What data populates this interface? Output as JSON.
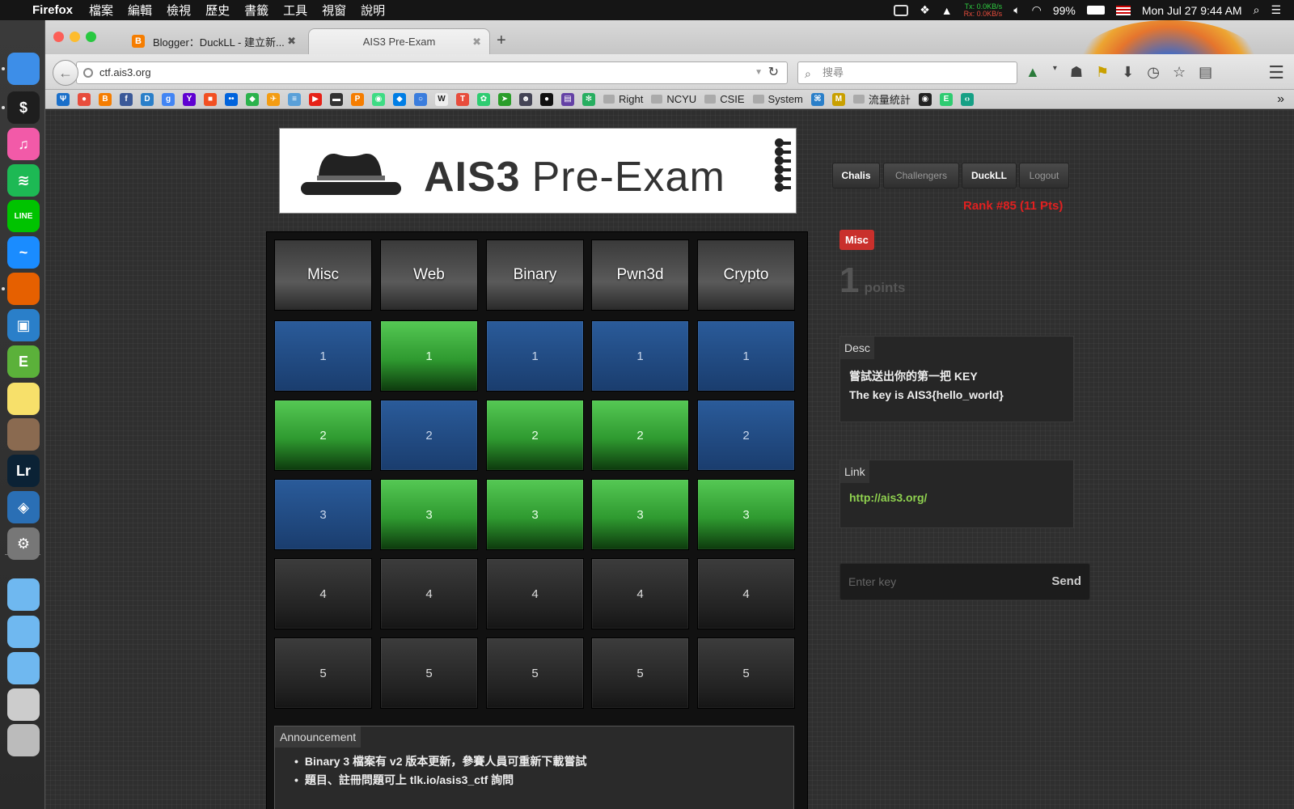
{
  "menubar": {
    "app": "Firefox",
    "menus": [
      "檔案",
      "編輯",
      "檢視",
      "歷史",
      "書籤",
      "工具",
      "視窗",
      "說明"
    ],
    "net_tx": "Tx:",
    "net_tx_val": "0.0KB/s",
    "net_rx": "Rx:",
    "net_rx_val": "0.0KB/s",
    "battery": "99%",
    "datetime": "Mon Jul 27  9:44 AM"
  },
  "dock": {
    "items": [
      {
        "name": "finder",
        "color": "#3d8ee8",
        "label": ""
      },
      {
        "name": "terminal",
        "color": "#1e1e1e",
        "label": "$"
      },
      {
        "name": "itunes",
        "color": "#f25aa8",
        "label": "♫"
      },
      {
        "name": "spotify",
        "color": "#1db954",
        "label": "≋"
      },
      {
        "name": "line",
        "color": "#00c300",
        "label": "LINE"
      },
      {
        "name": "messenger",
        "color": "#1a8cff",
        "label": "~"
      },
      {
        "name": "firefox",
        "color": "#e66000",
        "label": ""
      },
      {
        "name": "app-blue",
        "color": "#2a7fc9",
        "label": "▣"
      },
      {
        "name": "evernote",
        "color": "#5bb13a",
        "label": "E"
      },
      {
        "name": "stickies",
        "color": "#f7e06a",
        "label": ""
      },
      {
        "name": "armadillo",
        "color": "#8a6a50",
        "label": ""
      },
      {
        "name": "lightroom",
        "color": "#0b2235",
        "label": "Lr"
      },
      {
        "name": "virtualbox",
        "color": "#2a6fb5",
        "label": "◈"
      },
      {
        "name": "system-prefs",
        "color": "#777",
        "label": "⚙"
      },
      {
        "name": "dropbox-folder",
        "color": "#6fb8f0",
        "label": ""
      },
      {
        "name": "drive-folder",
        "color": "#6fb8f0",
        "label": ""
      },
      {
        "name": "folder",
        "color": "#6fb8f0",
        "label": ""
      },
      {
        "name": "disk",
        "color": "#ccc",
        "label": ""
      },
      {
        "name": "trash",
        "color": "#bbb",
        "label": ""
      }
    ]
  },
  "tabs": [
    {
      "title": "Blogger：DuckLL - 建立新...",
      "close": "✖"
    },
    {
      "title": "AIS3 Pre-Exam",
      "close": "✖"
    }
  ],
  "newtab": "+",
  "url": "ctf.ais3.org",
  "search_placeholder": "搜尋",
  "bookmarks": {
    "icons": [
      {
        "name": "bm-tt",
        "color": "#1a6fc9",
        "t": "Ψ"
      },
      {
        "name": "bm-maps",
        "color": "#e74c3c",
        "t": "●"
      },
      {
        "name": "bm-blogger",
        "color": "#f57d00",
        "t": "B"
      },
      {
        "name": "bm-facebook",
        "color": "#3b5998",
        "t": "f"
      },
      {
        "name": "bm-dict",
        "color": "#2a7fc9",
        "t": "D"
      },
      {
        "name": "bm-google",
        "color": "#4285f4",
        "t": "g"
      },
      {
        "name": "bm-yahoo",
        "color": "#5f01d1",
        "t": "Y"
      },
      {
        "name": "bm-windows",
        "color": "#f25022",
        "t": "■"
      },
      {
        "name": "bm-flickr",
        "color": "#0063dc",
        "t": "••"
      },
      {
        "name": "bm-feedly",
        "color": "#2bb24c",
        "t": "◆"
      },
      {
        "name": "bm-bird",
        "color": "#f39c12",
        "t": "✈"
      },
      {
        "name": "bm-doc",
        "color": "#5aa0d8",
        "t": "≡"
      },
      {
        "name": "bm-youtube",
        "color": "#e62117",
        "t": "▶"
      },
      {
        "name": "bm-card",
        "color": "#333",
        "t": "▬"
      },
      {
        "name": "bm-p",
        "color": "#f57d00",
        "t": "P"
      },
      {
        "name": "bm-android",
        "color": "#3ddc84",
        "t": "◉"
      },
      {
        "name": "bm-dropbox",
        "color": "#007ee5",
        "t": "◆"
      },
      {
        "name": "bm-circle",
        "color": "#3b7ddd",
        "t": "○"
      },
      {
        "name": "bm-wikipedia",
        "color": "#eee",
        "t": "W"
      },
      {
        "name": "bm-t",
        "color": "#e74c3c",
        "t": "T"
      },
      {
        "name": "bm-green",
        "color": "#2ecc71",
        "t": "✿"
      },
      {
        "name": "bm-plane",
        "color": "#2a9d2a",
        "t": "➤"
      },
      {
        "name": "bm-face",
        "color": "#445",
        "t": "☻"
      },
      {
        "name": "bm-lemon",
        "color": "#111",
        "t": "●"
      },
      {
        "name": "bm-twitch",
        "color": "#6441a5",
        "t": "▤"
      },
      {
        "name": "bm-leaf",
        "color": "#27ae60",
        "t": "✻"
      }
    ],
    "folders": [
      "Right",
      "NCYU",
      "CSIE",
      "System"
    ],
    "extra_label": "流量統計",
    "more": "»"
  },
  "banner": {
    "title_bold": "AIS3",
    "title_rest": "Pre-Exam"
  },
  "categories": [
    "Misc",
    "Web",
    "Binary",
    "Pwn3d",
    "Crypto"
  ],
  "grid": [
    [
      "blue",
      "green",
      "blue",
      "blue",
      "blue"
    ],
    [
      "green",
      "blue",
      "green",
      "green",
      "blue"
    ],
    [
      "blue",
      "green",
      "green",
      "green",
      "green"
    ],
    [
      "gray",
      "gray",
      "gray",
      "gray",
      "gray"
    ],
    [
      "gray",
      "gray",
      "gray",
      "gray",
      "gray"
    ]
  ],
  "rows": [
    "1",
    "2",
    "3",
    "4",
    "5"
  ],
  "announcement": {
    "header": "Announcement",
    "items": [
      "Binary 3 檔案有 v2 版本更新，參賽人員可重新下載嘗試",
      "題目、註冊問題可上 tlk.io/asis3_ctf 詢問"
    ]
  },
  "nav": {
    "chalis": "Chalis",
    "challengers": "Challengers",
    "user": "DuckLL",
    "logout": "Logout"
  },
  "rank": "Rank #85 (11 Pts)",
  "challenge": {
    "category": "Misc",
    "points": "1",
    "points_unit": "points",
    "desc_header": "Desc",
    "desc_line1": "嘗試送出你的第一把 KEY",
    "desc_line2": "The key is AIS3{hello_world}",
    "link_header": "Link",
    "link": "http://ais3.org/",
    "key_placeholder": "Enter key",
    "send": "Send"
  },
  "colors": {
    "solved": "#2f9a30",
    "unsolved": "#1a3d6e",
    "locked": "#232323",
    "rank": "#e02020"
  }
}
